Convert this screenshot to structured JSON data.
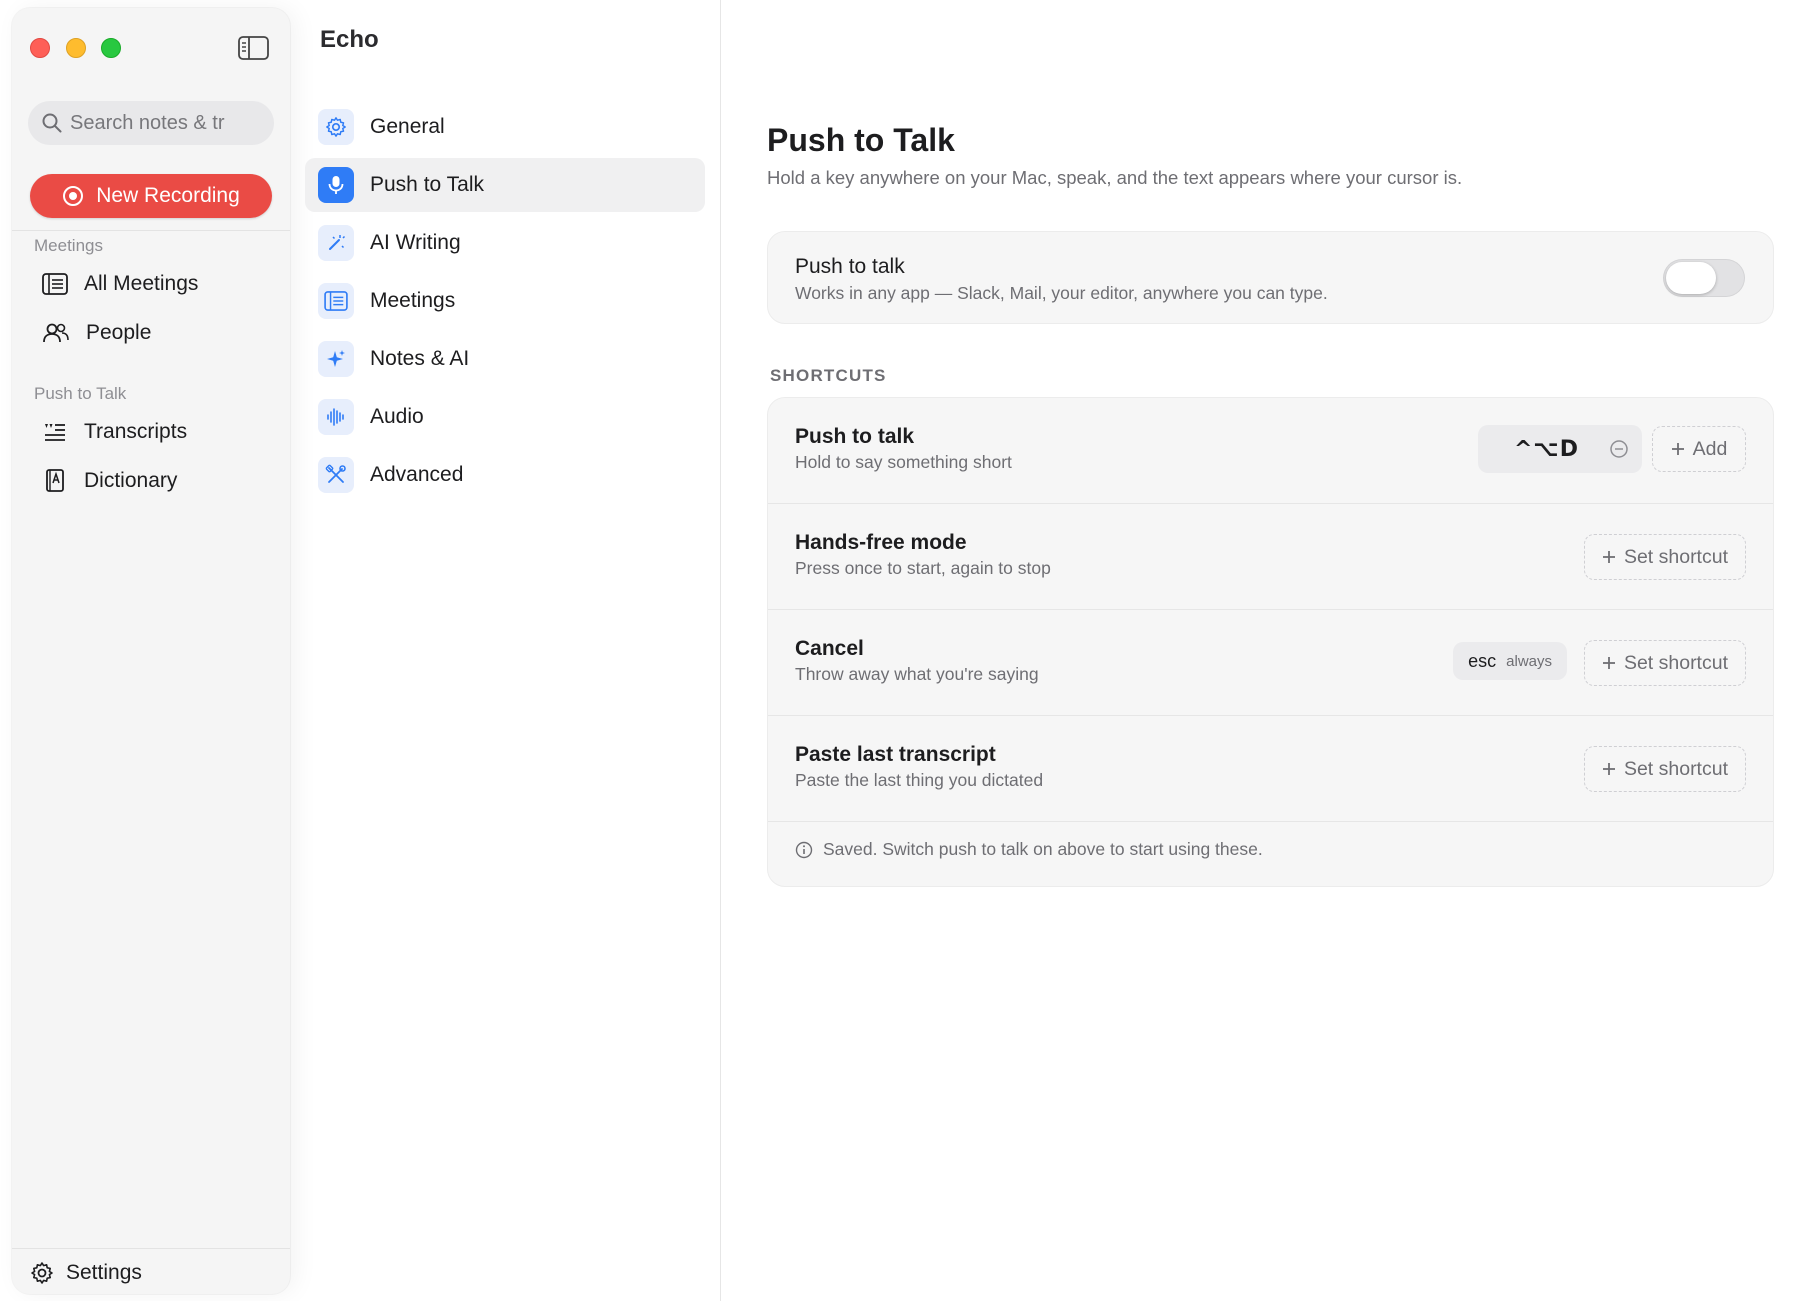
{
  "app": {
    "title": "Echo"
  },
  "sidebar": {
    "search_placeholder": "Search notes & tr",
    "new_recording_label": "New Recording",
    "sections": [
      {
        "label": "Meetings",
        "items": [
          {
            "label": "All Meetings",
            "icon": "list-icon"
          },
          {
            "label": "People",
            "icon": "people-icon"
          }
        ]
      },
      {
        "label": "Push to Talk",
        "items": [
          {
            "label": "Transcripts",
            "icon": "transcripts-icon"
          },
          {
            "label": "Dictionary",
            "icon": "dictionary-icon"
          }
        ]
      }
    ],
    "settings_label": "Settings"
  },
  "settings_nav": [
    {
      "label": "General",
      "icon": "gear-icon",
      "active": false
    },
    {
      "label": "Push to Talk",
      "icon": "microphone-icon",
      "active": true
    },
    {
      "label": "AI Writing",
      "icon": "magic-wand-icon",
      "active": false
    },
    {
      "label": "Meetings",
      "icon": "list-icon",
      "active": false
    },
    {
      "label": "Notes & AI",
      "icon": "sparkle-icon",
      "active": false
    },
    {
      "label": "Audio",
      "icon": "waveform-icon",
      "active": false
    },
    {
      "label": "Advanced",
      "icon": "tools-icon",
      "active": false
    }
  ],
  "main": {
    "title": "Push to Talk",
    "subtitle": "Hold a key anywhere on your Mac, speak, and the text appears where your cursor is.",
    "toggle_card": {
      "title": "Push to talk",
      "description": "Works in any app — Slack, Mail, your editor, anywhere you can type.",
      "enabled": false
    },
    "shortcuts_label": "SHORTCUTS",
    "shortcuts": [
      {
        "title": "Push to talk",
        "description": "Hold to say something short",
        "key": "^⌥D",
        "add_label": "Add"
      },
      {
        "title": "Hands-free mode",
        "description": "Press once to start, again to stop",
        "set_label": "Set shortcut"
      },
      {
        "title": "Cancel",
        "description": "Throw away what you're saying",
        "fixed_key": "esc",
        "fixed_note": "always",
        "set_label": "Set shortcut"
      },
      {
        "title": "Paste last transcript",
        "description": "Paste the last thing you dictated",
        "set_label": "Set shortcut"
      }
    ],
    "footer_note": "Saved. Switch push to talk on above to start using these."
  },
  "colors": {
    "accent": "#2f7cf6",
    "record": "#ea4b45",
    "icon_bg": "#e7eefc"
  }
}
